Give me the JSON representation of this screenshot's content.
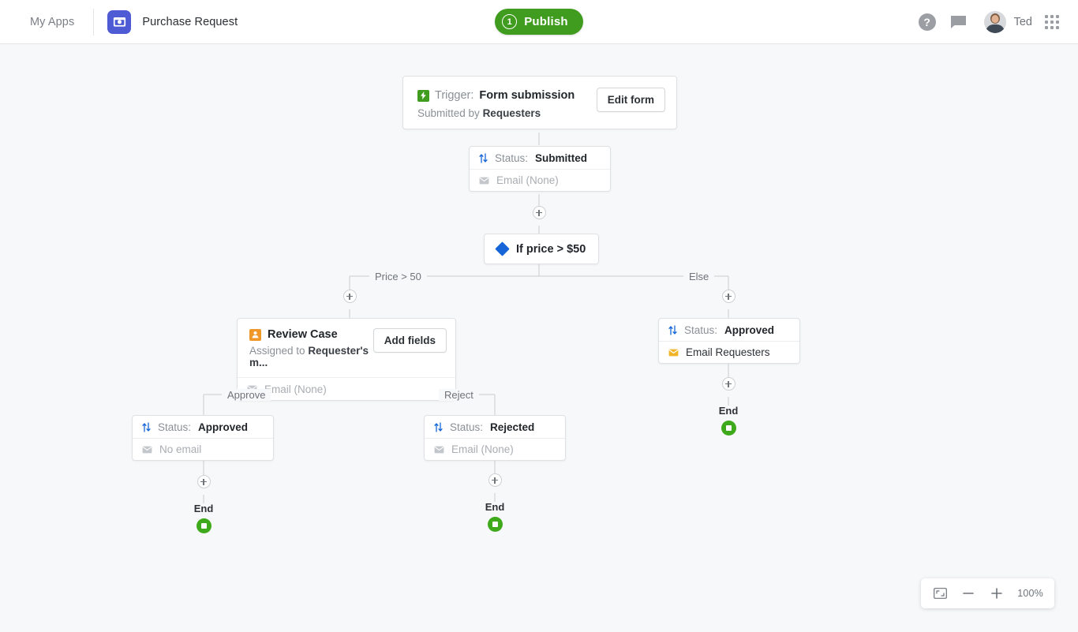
{
  "header": {
    "my_apps": "My Apps",
    "app_title": "Purchase Request",
    "app_icon": "money-app-icon",
    "publish": {
      "badge": "1",
      "label": "Publish"
    },
    "help_icon": "help-icon",
    "help_glyph": "?",
    "chat_icon": "chat-bubble-icon",
    "user_name": "Ted",
    "avatar": "user-avatar",
    "apps_grid_icon": "apps-grid-icon"
  },
  "workflow": {
    "trigger": {
      "icon": "lightning-bolt-icon",
      "prefix": "Trigger:",
      "name": "Form submission",
      "submitted_prefix": "Submitted by",
      "submitted_by": "Requesters",
      "button": "Edit form"
    },
    "trigger_status": {
      "icon": "sort-arrows-icon",
      "status_prefix": "Status:",
      "status_value": "Submitted",
      "email_icon": "envelope-icon",
      "email_text": "Email (None)"
    },
    "condition": {
      "icon": "diamond-icon",
      "label": "If price > $50"
    },
    "branches": {
      "true_label": "Price > 50",
      "false_label": "Else"
    },
    "review": {
      "icon": "person-badge-icon",
      "title": "Review Case",
      "assigned_prefix": "Assigned to",
      "assigned_to": "Requester's m...",
      "button": "Add fields",
      "email_icon": "envelope-icon",
      "email_text": "Email (None)"
    },
    "review_branches": {
      "approve_label": "Approve",
      "reject_label": "Reject"
    },
    "approve_node": {
      "icon": "sort-arrows-icon",
      "status_prefix": "Status:",
      "status_value": "Approved",
      "email_icon": "envelope-icon",
      "email_text": "No email"
    },
    "reject_node": {
      "icon": "sort-arrows-icon",
      "status_prefix": "Status:",
      "status_value": "Rejected",
      "email_icon": "envelope-icon",
      "email_text": "Email (None)"
    },
    "else_node": {
      "icon": "sort-arrows-icon",
      "status_prefix": "Status:",
      "status_value": "Approved",
      "email_icon": "envelope-filled-icon",
      "email_text": "Email Requesters"
    },
    "end_left": "End",
    "end_middle": "End",
    "end_right": "End"
  },
  "zoombar": {
    "fit_icon": "fit-to-screen-icon",
    "zoom_out_icon": "minus-icon",
    "zoom_in_icon": "plus-icon",
    "zoom_level": "100%"
  },
  "colors": {
    "publish_green": "#3f9c1e",
    "end_green": "#3fa91c",
    "app_purple": "#4f5bd5",
    "condition_blue": "#1565d8",
    "person_orange": "#f0972a",
    "canvas_bg": "#f7f8f9"
  }
}
